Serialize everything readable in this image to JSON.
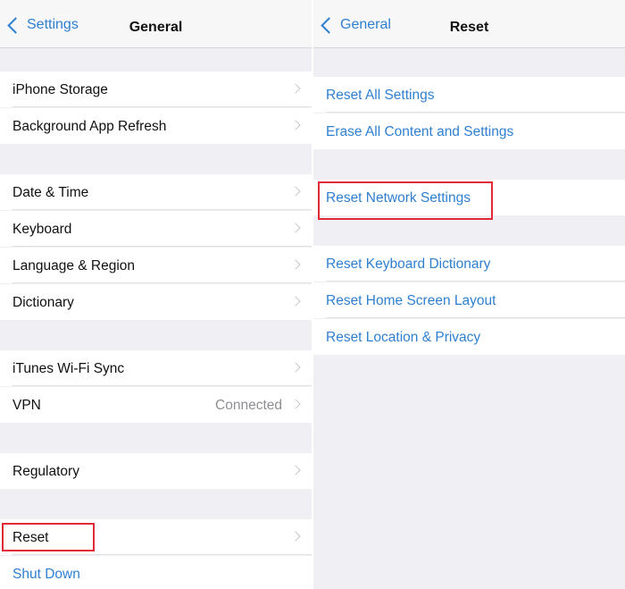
{
  "left": {
    "nav": {
      "back_label": "Settings",
      "title": "General"
    },
    "rows": [
      {
        "label": "iPhone Storage"
      },
      {
        "label": "Background App Refresh"
      },
      {
        "label": "Date & Time"
      },
      {
        "label": "Keyboard"
      },
      {
        "label": "Language & Region"
      },
      {
        "label": "Dictionary"
      },
      {
        "label": "iTunes Wi-Fi Sync"
      },
      {
        "label": "VPN",
        "detail": "Connected"
      },
      {
        "label": "Regulatory"
      },
      {
        "label": "Reset",
        "highlighted": true
      },
      {
        "label": "Shut Down"
      }
    ]
  },
  "right": {
    "nav": {
      "back_label": "General",
      "title": "Reset"
    },
    "rows": [
      {
        "label": "Reset All Settings"
      },
      {
        "label": "Erase All Content and Settings"
      },
      {
        "label": "Reset Network Settings",
        "highlighted": true
      },
      {
        "label": "Reset Keyboard Dictionary"
      },
      {
        "label": "Reset Home Screen Layout"
      },
      {
        "label": "Reset Location & Privacy"
      }
    ]
  },
  "colors": {
    "accent": "#2f7fd0",
    "highlight": "#e02b36",
    "background": "#efeff4"
  }
}
